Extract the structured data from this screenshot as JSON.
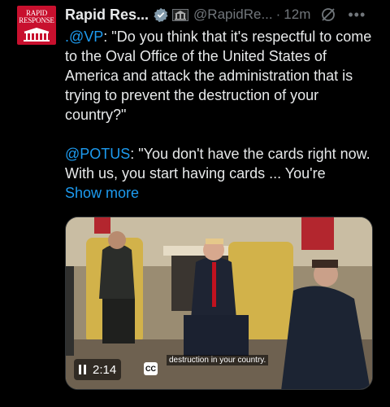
{
  "account": {
    "avatar_text": "RAPID RESPONSE",
    "name": "Rapid Res...",
    "handle": "@RapidRe...",
    "separator": "·",
    "time": "12m"
  },
  "tweet": {
    "para1_mention": ".@VP",
    "para1_text": ": \"Do you think that it's respectful to come to the Oval Office of the United States of America and attack the administration that is trying to prevent the destruction of your country?\"",
    "para2_mention": "@POTUS",
    "para2_text": ": \"You don't have the cards right now. With us, you start having cards ... You're",
    "show_more": "Show more"
  },
  "video": {
    "caption": "destruction in your country.",
    "duration": "2:14",
    "cc_label": "CC"
  },
  "icons": {
    "verified": "verified-badge-icon",
    "government": "government-building-icon",
    "grok": "grok-icon",
    "more": "more-icon",
    "pause": "pause-icon"
  },
  "colors": {
    "background": "#000000",
    "text": "#e7e9ea",
    "secondary": "#71767b",
    "link": "#1d9bf0",
    "avatar": "#c8102e"
  }
}
